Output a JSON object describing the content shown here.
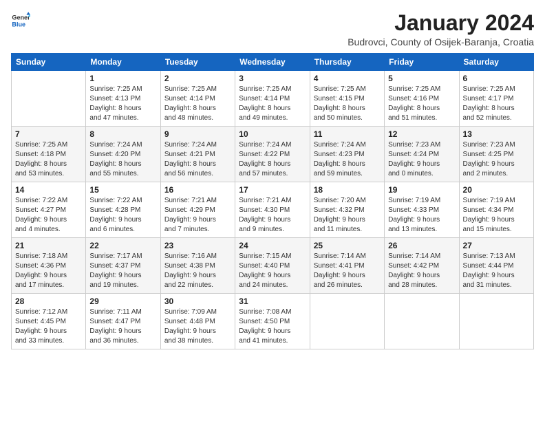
{
  "header": {
    "logo_line1": "General",
    "logo_line2": "Blue",
    "month_year": "January 2024",
    "location": "Budrovci, County of Osijek-Baranja, Croatia"
  },
  "weekdays": [
    "Sunday",
    "Monday",
    "Tuesday",
    "Wednesday",
    "Thursday",
    "Friday",
    "Saturday"
  ],
  "weeks": [
    [
      {
        "day": "",
        "info": ""
      },
      {
        "day": "1",
        "info": "Sunrise: 7:25 AM\nSunset: 4:13 PM\nDaylight: 8 hours\nand 47 minutes."
      },
      {
        "day": "2",
        "info": "Sunrise: 7:25 AM\nSunset: 4:14 PM\nDaylight: 8 hours\nand 48 minutes."
      },
      {
        "day": "3",
        "info": "Sunrise: 7:25 AM\nSunset: 4:14 PM\nDaylight: 8 hours\nand 49 minutes."
      },
      {
        "day": "4",
        "info": "Sunrise: 7:25 AM\nSunset: 4:15 PM\nDaylight: 8 hours\nand 50 minutes."
      },
      {
        "day": "5",
        "info": "Sunrise: 7:25 AM\nSunset: 4:16 PM\nDaylight: 8 hours\nand 51 minutes."
      },
      {
        "day": "6",
        "info": "Sunrise: 7:25 AM\nSunset: 4:17 PM\nDaylight: 8 hours\nand 52 minutes."
      }
    ],
    [
      {
        "day": "7",
        "info": "Sunrise: 7:25 AM\nSunset: 4:18 PM\nDaylight: 8 hours\nand 53 minutes."
      },
      {
        "day": "8",
        "info": "Sunrise: 7:24 AM\nSunset: 4:20 PM\nDaylight: 8 hours\nand 55 minutes."
      },
      {
        "day": "9",
        "info": "Sunrise: 7:24 AM\nSunset: 4:21 PM\nDaylight: 8 hours\nand 56 minutes."
      },
      {
        "day": "10",
        "info": "Sunrise: 7:24 AM\nSunset: 4:22 PM\nDaylight: 8 hours\nand 57 minutes."
      },
      {
        "day": "11",
        "info": "Sunrise: 7:24 AM\nSunset: 4:23 PM\nDaylight: 8 hours\nand 59 minutes."
      },
      {
        "day": "12",
        "info": "Sunrise: 7:23 AM\nSunset: 4:24 PM\nDaylight: 9 hours\nand 0 minutes."
      },
      {
        "day": "13",
        "info": "Sunrise: 7:23 AM\nSunset: 4:25 PM\nDaylight: 9 hours\nand 2 minutes."
      }
    ],
    [
      {
        "day": "14",
        "info": "Sunrise: 7:22 AM\nSunset: 4:27 PM\nDaylight: 9 hours\nand 4 minutes."
      },
      {
        "day": "15",
        "info": "Sunrise: 7:22 AM\nSunset: 4:28 PM\nDaylight: 9 hours\nand 6 minutes."
      },
      {
        "day": "16",
        "info": "Sunrise: 7:21 AM\nSunset: 4:29 PM\nDaylight: 9 hours\nand 7 minutes."
      },
      {
        "day": "17",
        "info": "Sunrise: 7:21 AM\nSunset: 4:30 PM\nDaylight: 9 hours\nand 9 minutes."
      },
      {
        "day": "18",
        "info": "Sunrise: 7:20 AM\nSunset: 4:32 PM\nDaylight: 9 hours\nand 11 minutes."
      },
      {
        "day": "19",
        "info": "Sunrise: 7:19 AM\nSunset: 4:33 PM\nDaylight: 9 hours\nand 13 minutes."
      },
      {
        "day": "20",
        "info": "Sunrise: 7:19 AM\nSunset: 4:34 PM\nDaylight: 9 hours\nand 15 minutes."
      }
    ],
    [
      {
        "day": "21",
        "info": "Sunrise: 7:18 AM\nSunset: 4:36 PM\nDaylight: 9 hours\nand 17 minutes."
      },
      {
        "day": "22",
        "info": "Sunrise: 7:17 AM\nSunset: 4:37 PM\nDaylight: 9 hours\nand 19 minutes."
      },
      {
        "day": "23",
        "info": "Sunrise: 7:16 AM\nSunset: 4:38 PM\nDaylight: 9 hours\nand 22 minutes."
      },
      {
        "day": "24",
        "info": "Sunrise: 7:15 AM\nSunset: 4:40 PM\nDaylight: 9 hours\nand 24 minutes."
      },
      {
        "day": "25",
        "info": "Sunrise: 7:14 AM\nSunset: 4:41 PM\nDaylight: 9 hours\nand 26 minutes."
      },
      {
        "day": "26",
        "info": "Sunrise: 7:14 AM\nSunset: 4:42 PM\nDaylight: 9 hours\nand 28 minutes."
      },
      {
        "day": "27",
        "info": "Sunrise: 7:13 AM\nSunset: 4:44 PM\nDaylight: 9 hours\nand 31 minutes."
      }
    ],
    [
      {
        "day": "28",
        "info": "Sunrise: 7:12 AM\nSunset: 4:45 PM\nDaylight: 9 hours\nand 33 minutes."
      },
      {
        "day": "29",
        "info": "Sunrise: 7:11 AM\nSunset: 4:47 PM\nDaylight: 9 hours\nand 36 minutes."
      },
      {
        "day": "30",
        "info": "Sunrise: 7:09 AM\nSunset: 4:48 PM\nDaylight: 9 hours\nand 38 minutes."
      },
      {
        "day": "31",
        "info": "Sunrise: 7:08 AM\nSunset: 4:50 PM\nDaylight: 9 hours\nand 41 minutes."
      },
      {
        "day": "",
        "info": ""
      },
      {
        "day": "",
        "info": ""
      },
      {
        "day": "",
        "info": ""
      }
    ]
  ]
}
